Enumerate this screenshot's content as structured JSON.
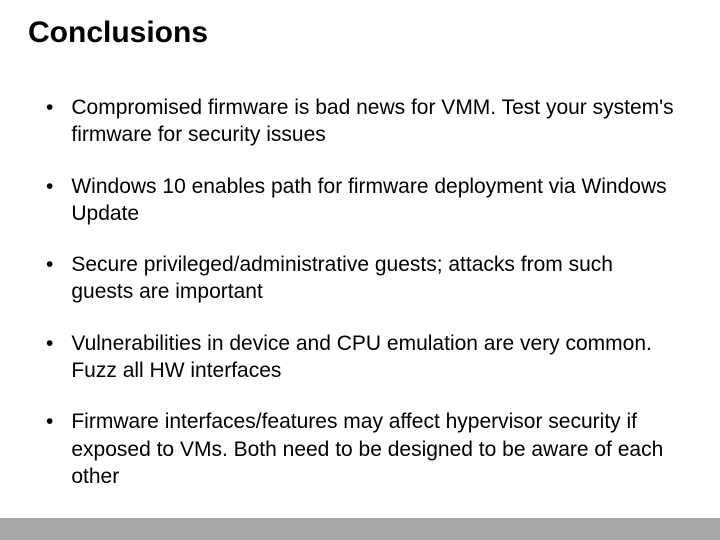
{
  "title": "Conclusions",
  "bullets": [
    "Compromised firmware is bad news for VMM. Test your system's firmware for security issues",
    "Windows 10 enables path for firmware deployment via Windows Update",
    "Secure privileged/administrative guests; attacks from such guests are important",
    "Vulnerabilities in device and CPU emulation are very common. Fuzz all HW interfaces",
    "Firmware interfaces/features may affect hypervisor security if exposed to VMs. Both need to be designed to be aware of each other"
  ]
}
